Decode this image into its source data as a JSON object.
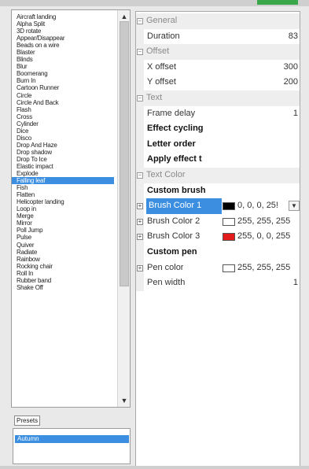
{
  "effects_list": {
    "items": [
      "Aircraft landing",
      "Alpha Split",
      "3D rotate",
      "Appear/Disappear",
      "Beads on a wire",
      "Blaster",
      "Blinds",
      "Blur",
      "Boomerang",
      "Burn In",
      "Cartoon Runner",
      "Circle",
      "Circle And Back",
      "Flash",
      "Cross",
      "Cylinder",
      "Dice",
      "Disco",
      "Drop And Haze",
      "Drop shadow",
      "Drop To Ice",
      "Elastic impact",
      "Explode",
      "Falling leaf",
      "Fish",
      "Flatten",
      "Helicopter landing",
      "Loop in",
      "Merge",
      "Mirror",
      "Poll Jump",
      "Pulse",
      "Quiver",
      "Radiate",
      "Rainbow",
      "Rocking chair",
      "Roll In",
      "Rubber band",
      "Shake Off"
    ],
    "selected": "Falling leaf"
  },
  "presets": {
    "label": "Presets",
    "items": [
      "Autumn"
    ]
  },
  "properties": {
    "general": {
      "label": "General",
      "duration_label": "Duration",
      "duration_value": "83"
    },
    "offset": {
      "label": "Offset",
      "x_label": "X offset",
      "x_value": "300",
      "y_label": "Y offset",
      "y_value": "200"
    },
    "text": {
      "label": "Text",
      "frame_delay_label": "Frame delay",
      "frame_delay_value": "1",
      "effect_cycling": "Effect cycling",
      "letter_order": "Letter order",
      "apply_effect": "Apply effect t"
    },
    "text_color": {
      "label": "Text Color",
      "custom_brush": "Custom brush",
      "brush1_label": "Brush Color 1",
      "brush1_value": "0, 0, 0, 25!",
      "brush1_color": "#000000",
      "brush2_label": "Brush Color 2",
      "brush2_value": "255, 255, 255",
      "brush2_color": "#ffffff",
      "brush3_label": "Brush Color 3",
      "brush3_value": "255, 0, 0, 255",
      "brush3_color": "#e21b1b",
      "custom_pen": "Custom pen",
      "pen_label": "Pen color",
      "pen_value": "255, 255, 255",
      "pen_color": "#ffffff",
      "pen_width_label": "Pen width",
      "pen_width_value": "1"
    }
  },
  "icons": {
    "collapse": "minus-box-icon",
    "expand": "plus-box-icon",
    "scroll_up": "scroll-up-arrow-icon",
    "scroll_down": "scroll-down-arrow-icon",
    "dropdown": "chevron-down-icon"
  }
}
